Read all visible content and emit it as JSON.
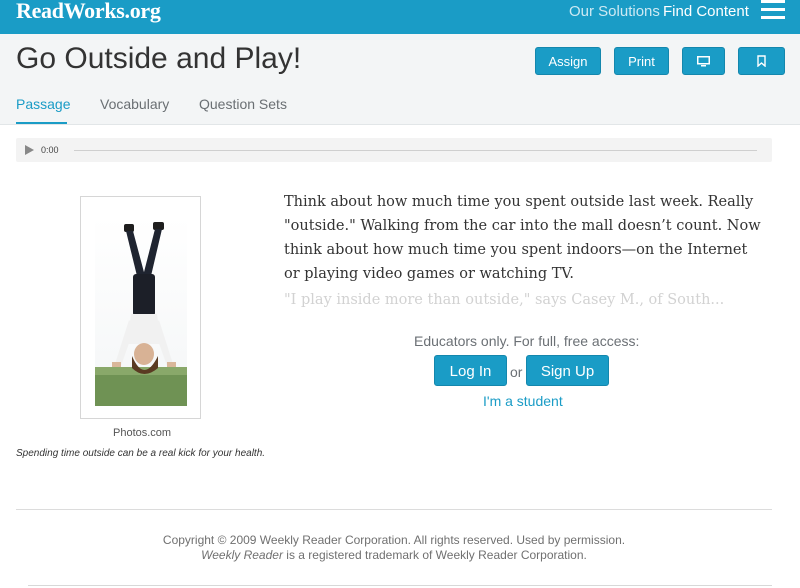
{
  "topbar": {
    "logo": "ReadWorks.org",
    "nav": {
      "solutions": "Our Solutions",
      "find_content": "Find Content"
    },
    "menu_icon": "hamburger-menu-icon",
    "color": "#1a9cc6"
  },
  "header": {
    "title": "Go Outside and Play!",
    "buttons": {
      "assign": "Assign",
      "print": "Print",
      "present_icon": "monitor-icon",
      "bookmark_icon": "bookmark-icon"
    },
    "tabs": [
      {
        "label": "Passage",
        "active": true
      },
      {
        "label": "Vocabulary",
        "active": false
      },
      {
        "label": "Question Sets",
        "active": false
      }
    ]
  },
  "audio": {
    "play_icon": "play-icon",
    "time": "0:00"
  },
  "figure": {
    "credit": "Photos.com",
    "caption": "Spending time outside can be a real kick for your health."
  },
  "passage": {
    "paragraph_1": "Think about how much time you spent outside last week. Really \"outside.\" Walking from the car into the mall doesn’t count. Now think about how much time you spent indoors—on the Internet or playing video games or watching TV.",
    "paragraph_2_fade": "\"I play inside more than outside,\" says Casey M., of South..."
  },
  "access": {
    "prompt": "Educators only. For full, free access:",
    "login": "Log In",
    "or": "or",
    "signup": "Sign Up",
    "student": "I'm a student"
  },
  "footer": {
    "copyright": "Copyright © 2009 Weekly Reader Corporation. All rights reserved. Used by permission.",
    "trademark_name": "Weekly Reader",
    "trademark_rest": " is a registered trademark of Weekly Reader Corporation."
  }
}
